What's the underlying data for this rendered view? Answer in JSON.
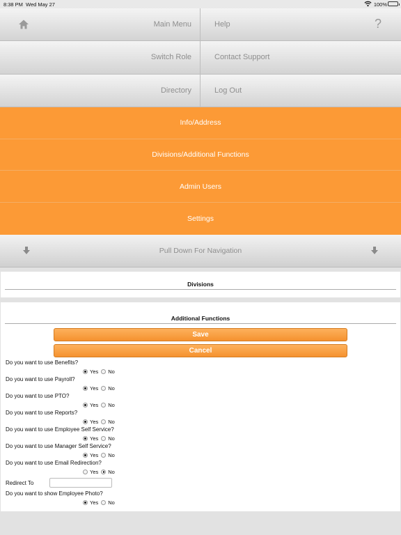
{
  "status_bar": {
    "time": "8:38 PM",
    "date": "Wed May 27",
    "battery": "100%"
  },
  "menu": {
    "main_menu": "Main Menu",
    "help": "Help",
    "help_glyph": "?",
    "switch_role": "Switch Role",
    "contact_support": "Contact Support",
    "directory": "Directory",
    "log_out": "Log Out"
  },
  "orange_menu": {
    "info_address": "Info/Address",
    "divisions_additional": "Divisions/Additional Functions",
    "admin_users": "Admin Users",
    "settings": "Settings"
  },
  "pull_bar": {
    "label": "Pull Down For Navigation"
  },
  "divisions": {
    "title": "Divisions"
  },
  "functions": {
    "title": "Additional Functions",
    "save": "Save",
    "cancel": "Cancel",
    "yes": "Yes",
    "no": "No",
    "questions": [
      {
        "text": "Do you want to use Benefits?",
        "selected": "yes"
      },
      {
        "text": "Do you want to use Payroll?",
        "selected": "yes"
      },
      {
        "text": "Do you want to use PTO?",
        "selected": "yes"
      },
      {
        "text": "Do you want to use Reports?",
        "selected": "yes"
      },
      {
        "text": "Do you want to use Employee Self Service?",
        "selected": "yes"
      },
      {
        "text": "Do you want to use Manager Self Service?",
        "selected": "yes"
      },
      {
        "text": "Do you want to use Email Redirection?",
        "selected": "no"
      },
      {
        "text": "Do you want to show Employee Photo?",
        "selected": "yes"
      }
    ],
    "redirect_label": "Redirect To",
    "redirect_value": ""
  },
  "colors": {
    "accent": "#fc9a36",
    "menu_text": "#8e8e8e"
  }
}
